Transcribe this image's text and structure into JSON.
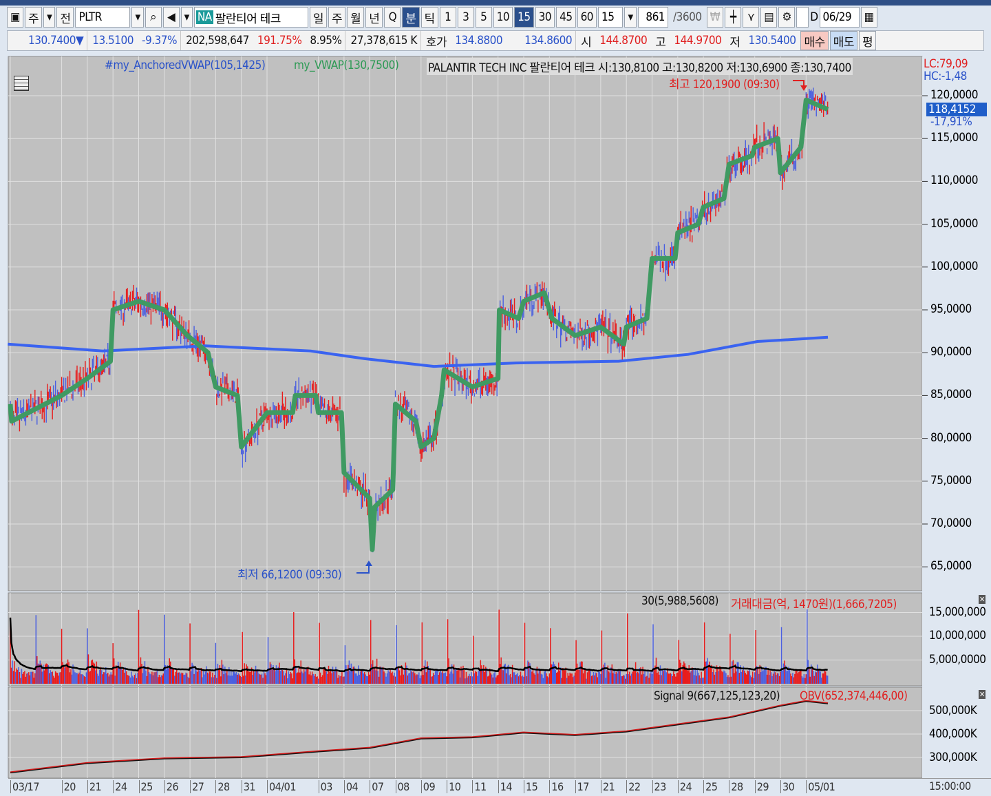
{
  "toolbar": {
    "type": "주",
    "mode": "전",
    "symbol": "PLTR",
    "na": "NA",
    "name": "팔란티어 테크",
    "periods": [
      "일",
      "주",
      "월",
      "년",
      "Q",
      "분",
      "틱"
    ],
    "minutes": [
      "1",
      "3",
      "5",
      "10",
      "15",
      "30",
      "45",
      "60"
    ],
    "interval": "15",
    "count": "861",
    "count_max": "/3600",
    "d_label": "D",
    "date": "06/29"
  },
  "quote": {
    "price": "130.7400▼",
    "change": "13.5100",
    "pct": "-9.37%",
    "volume": "202,598,647",
    "vol_ratio": "191.75%",
    "turnover": "8.95%",
    "amount": "27,378,615 K",
    "hoga_label": "호가",
    "ask": "134.8800",
    "bid": "134.8600",
    "open_label": "시",
    "open": "144.8700",
    "high_label": "고",
    "high": "144.9700",
    "low_label": "저",
    "low": "130.5400",
    "buy": "매수",
    "sell": "매도",
    "even": "평"
  },
  "legend": {
    "avwap": "#my_AnchoredVWAP(105,1425)",
    "vwap": "my_VWAP(130,7500)",
    "ohlc": "PALANTIR TECH INC  팔란티어 테크 시:130,8100 고:130,8200 저:130,6900 종:130,7400"
  },
  "annotations": {
    "high": "최고 120,1900 (09:30)",
    "low": "최저 66,1200 (09:30)"
  },
  "right": {
    "lc": "LC:79,09",
    "hc": "HC:-1,48",
    "current": "118,4152",
    "pct": "-17,91%"
  },
  "volume_panel": {
    "ma": "30(5,988,5608)",
    "amount": "거래대금(억, 1470원)(1,666,7205)",
    "ticks": [
      "15,000,000",
      "10,000,000",
      "5,000,0000"
    ]
  },
  "obv_panel": {
    "signal": "Signal 9(667,125,123,20)",
    "obv": "OBV(652,374,446,00)",
    "ticks": [
      "500,000K",
      "400,000K",
      "300,000K"
    ]
  },
  "colors": {
    "vwap": "#3f9a62",
    "avwap": "#3a63f0",
    "up": "#e81c1c",
    "down": "#4a5fe0"
  },
  "chart_data": {
    "type": "line",
    "price_ticks": [
      "120,0000",
      "115,0000",
      "110,0000",
      "105,0000",
      "100,0000",
      "95,0000",
      "90,0000",
      "85,0000",
      "80,0000",
      "75,0000",
      "70,0000",
      "65,0000"
    ],
    "price_range": [
      63.5,
      124.5
    ],
    "dates": [
      [
        "03/17",
        0
      ],
      [
        "20",
        2
      ],
      [
        "21",
        3
      ],
      [
        "24",
        4
      ],
      [
        "25",
        5
      ],
      [
        "26",
        6
      ],
      [
        "27",
        7
      ],
      [
        "28",
        8
      ],
      [
        "31",
        9
      ],
      [
        "04/01",
        10
      ],
      [
        "03",
        12
      ],
      [
        "04",
        13
      ],
      [
        "07",
        14
      ],
      [
        "08",
        15
      ],
      [
        "09",
        16
      ],
      [
        "10",
        17
      ],
      [
        "11",
        18
      ],
      [
        "14",
        19
      ],
      [
        "15",
        20
      ],
      [
        "16",
        21
      ],
      [
        "17",
        22
      ],
      [
        "21",
        23
      ],
      [
        "22",
        24
      ],
      [
        "23",
        25
      ],
      [
        "24",
        26
      ],
      [
        "25",
        27
      ],
      [
        "28",
        28
      ],
      [
        "29",
        29
      ],
      [
        "30",
        30
      ],
      [
        "05/01",
        31
      ]
    ],
    "time_label": "15:00:00",
    "vwap": [
      [
        0,
        84
      ],
      [
        0.05,
        82
      ],
      [
        2,
        85
      ],
      [
        3,
        87
      ],
      [
        3.9,
        89
      ],
      [
        4,
        95
      ],
      [
        5,
        96
      ],
      [
        6,
        95
      ],
      [
        6.9,
        92
      ],
      [
        7.7,
        90
      ],
      [
        8,
        86
      ],
      [
        8.85,
        85
      ],
      [
        9,
        79
      ],
      [
        10,
        83
      ],
      [
        11,
        83
      ],
      [
        11.1,
        85
      ],
      [
        11.9,
        85
      ],
      [
        12,
        83
      ],
      [
        12.9,
        83
      ],
      [
        13,
        76
      ],
      [
        14,
        73
      ],
      [
        14.1,
        67
      ],
      [
        14.2,
        72
      ],
      [
        14.9,
        74
      ],
      [
        15,
        84
      ],
      [
        15.8,
        82
      ],
      [
        16,
        79
      ],
      [
        16.5,
        80
      ],
      [
        16.8,
        85
      ],
      [
        16.9,
        88
      ],
      [
        18,
        86
      ],
      [
        19,
        87
      ],
      [
        19.05,
        95
      ],
      [
        19.8,
        94
      ],
      [
        20,
        96
      ],
      [
        20.8,
        97
      ],
      [
        21.1,
        94
      ],
      [
        22,
        92
      ],
      [
        23,
        93
      ],
      [
        23.9,
        91
      ],
      [
        24,
        93
      ],
      [
        24.8,
        94
      ],
      [
        25,
        101
      ],
      [
        25.9,
        101
      ],
      [
        26,
        104
      ],
      [
        26.8,
        105
      ],
      [
        27,
        107
      ],
      [
        27.8,
        108
      ],
      [
        28,
        112
      ],
      [
        28.9,
        113
      ],
      [
        29,
        114
      ],
      [
        29.9,
        115
      ],
      [
        30,
        111
      ],
      [
        30.8,
        114
      ],
      [
        31,
        119.5
      ],
      [
        31.85,
        118.4
      ]
    ],
    "anchored_vwap": [
      [
        -0.1,
        91
      ],
      [
        3.6,
        90.2
      ],
      [
        7.6,
        90.8
      ],
      [
        11.7,
        90.2
      ],
      [
        13.8,
        89.3
      ],
      [
        16.5,
        88.4
      ],
      [
        19.7,
        88.8
      ],
      [
        23.7,
        89
      ],
      [
        26.4,
        89.8
      ],
      [
        29.1,
        91.3
      ],
      [
        31.85,
        91.8
      ]
    ],
    "obv": [
      [
        0,
        235
      ],
      [
        3,
        275
      ],
      [
        6,
        295
      ],
      [
        9,
        300
      ],
      [
        12,
        325
      ],
      [
        14,
        340
      ],
      [
        16,
        380
      ],
      [
        18,
        385
      ],
      [
        20,
        405
      ],
      [
        22,
        395
      ],
      [
        24,
        410
      ],
      [
        26,
        440
      ],
      [
        28,
        470
      ],
      [
        30,
        520
      ],
      [
        31,
        540
      ],
      [
        31.85,
        530
      ]
    ]
  }
}
